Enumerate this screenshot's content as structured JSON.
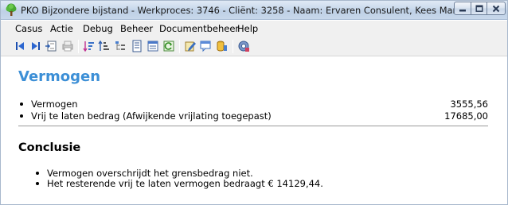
{
  "window": {
    "title": "PKO Bijzondere bijstand - Werkproces: 3746 - Cliënt: 3258 - Naam: Ervaren Consulent, Kees Mark",
    "controls": [
      "minimize-icon",
      "maximize-icon",
      "close-icon"
    ]
  },
  "menu": {
    "items": [
      "Casus",
      "Actie",
      "Debug",
      "Beheer",
      "Documentbeheer",
      "Help"
    ]
  },
  "toolbar": {
    "icons": [
      "first-record-icon",
      "last-record-icon",
      "open-case-icon",
      "print-icon",
      "sort-icon",
      "sort-descending-icon",
      "tree-icon",
      "document-icon",
      "list-icon",
      "refresh-icon",
      "edit-form-icon",
      "comment-icon",
      "database-icon",
      "settings-icon"
    ]
  },
  "main": {
    "section_title": "Vermogen",
    "items": [
      {
        "label": "Vermogen",
        "value": "3555,56"
      },
      {
        "label": "Vrij te laten bedrag (Afwijkende vrijlating toegepast)",
        "value": "17685,00"
      }
    ],
    "conclusion_title": "Conclusie",
    "conclusions": [
      "Vermogen overschrijdt het grensbedrag niet.",
      "Het resterende vrij te laten vermogen bedraagt € 14129,44."
    ]
  }
}
